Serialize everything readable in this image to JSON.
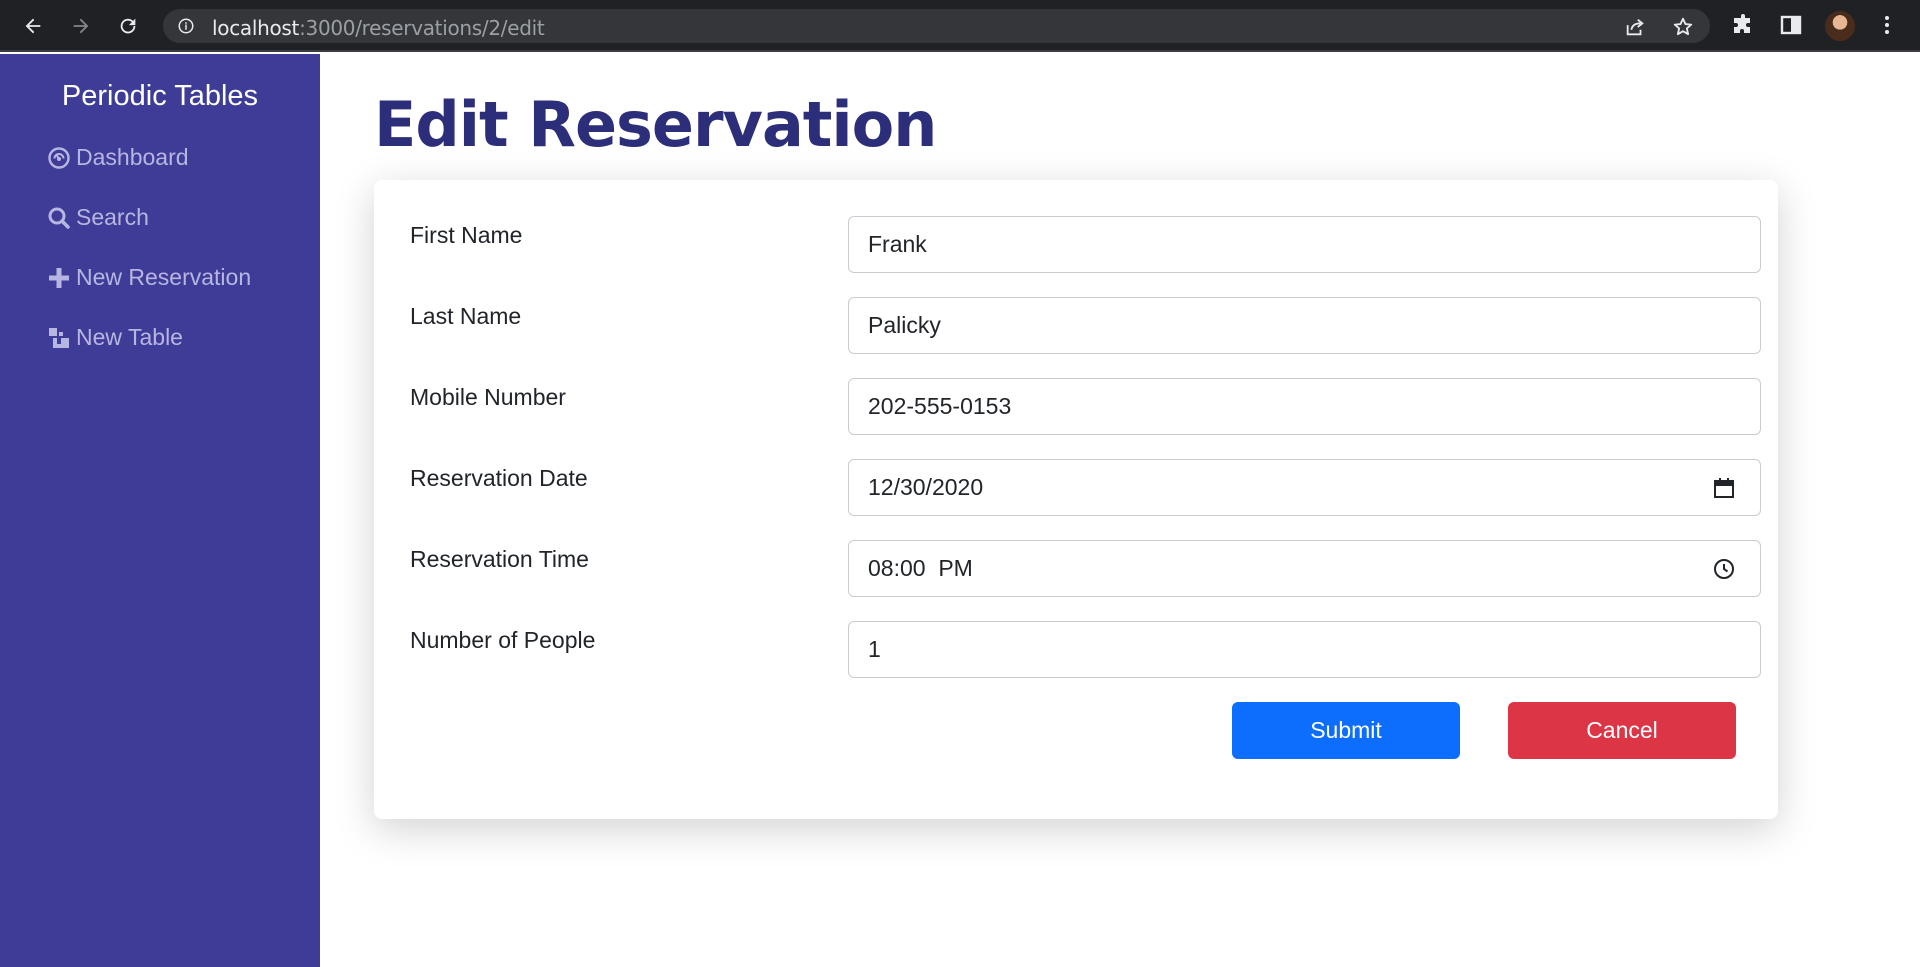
{
  "browser": {
    "url_host": "localhost",
    "url_path": ":3000/reservations/2/edit"
  },
  "sidebar": {
    "brand": "Periodic Tables",
    "items": [
      {
        "label": "Dashboard",
        "icon": "dashboard-gauge-icon"
      },
      {
        "label": "Search",
        "icon": "search-icon"
      },
      {
        "label": "New Reservation",
        "icon": "plus-icon"
      },
      {
        "label": "New Table",
        "icon": "layers-icon"
      }
    ]
  },
  "page": {
    "title": "Edit Reservation"
  },
  "form": {
    "first_name": {
      "label": "First Name",
      "value": "Frank"
    },
    "last_name": {
      "label": "Last Name",
      "value": "Palicky"
    },
    "mobile_number": {
      "label": "Mobile Number",
      "value": "202-555-0153"
    },
    "reservation_date": {
      "label": "Reservation Date",
      "value": "12/30/2020",
      "icon": "calendar-icon"
    },
    "reservation_time": {
      "label": "Reservation Time",
      "value": "08:00  PM",
      "icon": "clock-icon"
    },
    "people": {
      "label": "Number of People",
      "value": "1"
    },
    "submit_label": "Submit",
    "cancel_label": "Cancel"
  },
  "colors": {
    "sidebar_bg": "#3e3c96",
    "title": "#2c2e7a",
    "submit": "#0d6efd",
    "cancel": "#dc3545"
  }
}
